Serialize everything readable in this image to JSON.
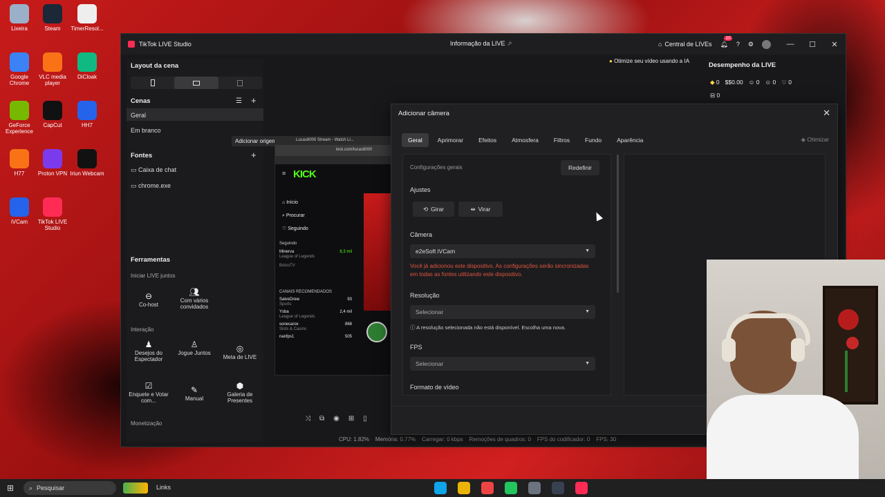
{
  "desktop_icons": [
    {
      "label": "Lixeira",
      "icon": "recycle-bin-icon",
      "color": "#9ab0c8"
    },
    {
      "label": "Steam",
      "icon": "steam-icon",
      "color": "#1b2838"
    },
    {
      "label": "TimerResol...",
      "icon": "timer-icon",
      "color": "#eeeeee"
    },
    {
      "label": "Google Chrome",
      "icon": "chrome-icon",
      "color": "#3b82f6"
    },
    {
      "label": "VLC media player",
      "icon": "vlc-icon",
      "color": "#f97316"
    },
    {
      "label": "DiCloak",
      "icon": "dicloak-icon",
      "color": "#10b981"
    },
    {
      "label": "GeForce Experience",
      "icon": "nvidia-icon",
      "color": "#76b900"
    },
    {
      "label": "CapCut",
      "icon": "capcut-icon",
      "color": "#111111"
    },
    {
      "label": "HH7",
      "icon": "hh7-icon",
      "color": "#2563eb"
    },
    {
      "label": "H77",
      "icon": "h77-icon",
      "color": "#f97316"
    },
    {
      "label": "Proton VPN",
      "icon": "proton-vpn-icon",
      "color": "#7c3aed"
    },
    {
      "label": "Iriun Webcam",
      "icon": "iriun-icon",
      "color": "#111111"
    },
    {
      "label": "iVCam",
      "icon": "ivcam-icon",
      "color": "#2563eb"
    },
    {
      "label": "TikTok LIVE Studio",
      "icon": "tiktok-icon",
      "color": "#fe2c55"
    }
  ],
  "app": {
    "title": "TikTok LIVE Studio",
    "center_title": "Informação da LIVE",
    "central_lives": "Central de LIVEs",
    "notif_count": "10",
    "ai_tip": "Otimize seu vídeo usando a IA"
  },
  "layout": {
    "title": "Layout da cena"
  },
  "scenes": {
    "title": "Cenas",
    "items": [
      "Geral",
      "Em branco"
    ]
  },
  "sources": {
    "title": "Fontes",
    "items": [
      "Caixa de chat",
      "chrome.exe"
    ]
  },
  "add_source": "Adicionar origem",
  "tools": {
    "title": "Ferramentas",
    "section1": "Iniciar LIVE juntos",
    "section2": "Interação",
    "section3": "Monetização",
    "items": [
      {
        "label": "Co-host",
        "icon": "cohost-icon"
      },
      {
        "label": "Com vários convidados",
        "icon": "multi-guest-icon"
      },
      {
        "label": "Desejos do Espectador",
        "icon": "wishes-icon"
      },
      {
        "label": "Jogue Juntos",
        "icon": "play-together-icon"
      },
      {
        "label": "Meta de LIVE",
        "icon": "goal-icon"
      },
      {
        "label": "Enquete e Votar com...",
        "icon": "poll-icon"
      },
      {
        "label": "Manual",
        "icon": "manual-icon"
      },
      {
        "label": "Galeria de Presentes",
        "icon": "gift-gallery-icon"
      }
    ]
  },
  "performance": {
    "title": "Desempenho da LIVE",
    "diamonds": "0",
    "money": "$0.00",
    "viewers": "0",
    "gifters": "0",
    "likes": "0",
    "shares": "0"
  },
  "preview": {
    "tab_title": "Lucas8000 Stream - Watch Li...",
    "url": "kick.com/lucas8000",
    "logo": "KICK",
    "nav": [
      "Início",
      "Procurar",
      "Seguindo"
    ],
    "following_label": "Seguindo",
    "following": [
      {
        "name": "Minerva",
        "game": "League of Legends",
        "viewers": "8,3 mil"
      },
      {
        "name": "BolsoTV",
        "game": "",
        "viewers": ""
      }
    ],
    "recommended_label": "CANAIS RECOMENDADOS",
    "recommended": [
      {
        "name": "SalveDrew",
        "game": "Sports",
        "viewers": "93"
      },
      {
        "name": "Ysba",
        "game": "League of Legends",
        "viewers": "2,4 mil"
      },
      {
        "name": "sonecarox",
        "game": "Slots & Casino",
        "viewers": "868"
      },
      {
        "name": "nanfps1",
        "game": "",
        "viewers": "505"
      }
    ]
  },
  "dialog": {
    "title": "Adicionar câmera",
    "tabs": [
      "Geral",
      "Aprimorar",
      "Efeitos",
      "Atmosfera",
      "Filtros",
      "Fundo",
      "Aparência"
    ],
    "active_tab": "Geral",
    "optimize": "Otimizar",
    "general_settings": "Configurações gerais",
    "reset": "Redefinir",
    "adjustments": "Ajustes",
    "rotate": "Girar",
    "flip": "Virar",
    "camera_label": "Câmera",
    "camera_value": "e2eSoft iVCam",
    "camera_warning": "Você já adicionou este dispositivo. As configurações serão sincronizadas em todas as fontes utilizando este dispositivo.",
    "resolution_label": "Resolução",
    "resolution_value": "Selecionar",
    "resolution_warning": "A resolução selecionada não está disponível. Escolha uma nova.",
    "fps_label": "FPS",
    "fps_value": "Selecionar",
    "video_format_label": "Formato de vídeo"
  },
  "status": {
    "cpu": "CPU: 1.82%",
    "memory": "Memória: 0.77%",
    "upload": "Carregar: 0 kbps",
    "dropped": "Remoções de quadros: 0",
    "encoder_fps": "FPS do codificador: 0",
    "fps": "FPS: 30"
  },
  "taskbar": {
    "search": "Pesquisar",
    "links": "Links",
    "apps": [
      {
        "icon": "edge-icon",
        "color": "#0ea5e9"
      },
      {
        "icon": "file-explorer-icon",
        "color": "#eab308"
      },
      {
        "icon": "chrome-icon",
        "color": "#ef4444"
      },
      {
        "icon": "whatsapp-icon",
        "color": "#22c55e"
      },
      {
        "icon": "calculator-icon",
        "color": "#6b7280"
      },
      {
        "icon": "obs-icon",
        "color": "#374151"
      },
      {
        "icon": "tiktok-icon",
        "color": "#fe2c55"
      }
    ]
  }
}
